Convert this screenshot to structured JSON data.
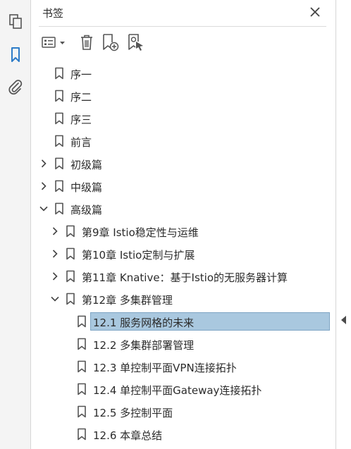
{
  "panel": {
    "title": "书签",
    "close_icon": "close-icon"
  },
  "rail": {
    "items": [
      {
        "icon": "pages-icon",
        "active": false
      },
      {
        "icon": "bookmark-icon",
        "active": true
      },
      {
        "icon": "attachment-icon",
        "active": false
      }
    ]
  },
  "toolbar": {
    "options_icon": "options-menu-icon",
    "delete_icon": "delete-icon",
    "new_bookmark_icon": "new-bookmark-icon",
    "new_from_structure_icon": "new-bookmark-from-structure-icon"
  },
  "colors": {
    "selection": "#a9c8df",
    "accent": "#2d7cc8"
  },
  "bookmarks": [
    {
      "label": "序一",
      "level": 0,
      "expander": "none",
      "selected": false
    },
    {
      "label": "序二",
      "level": 0,
      "expander": "none",
      "selected": false
    },
    {
      "label": "序三",
      "level": 0,
      "expander": "none",
      "selected": false
    },
    {
      "label": "前言",
      "level": 0,
      "expander": "none",
      "selected": false
    },
    {
      "label": "初级篇",
      "level": 0,
      "expander": "collapsed",
      "selected": false
    },
    {
      "label": "中级篇",
      "level": 0,
      "expander": "collapsed",
      "selected": false
    },
    {
      "label": "高级篇",
      "level": 0,
      "expander": "expanded",
      "selected": false
    },
    {
      "label": "第9章 Istio稳定性与运维",
      "level": 1,
      "expander": "collapsed",
      "selected": false
    },
    {
      "label": "第10章 Istio定制与扩展",
      "level": 1,
      "expander": "collapsed",
      "selected": false
    },
    {
      "label": "第11章 Knative：基于Istio的无服务器计算",
      "level": 1,
      "expander": "collapsed",
      "selected": false
    },
    {
      "label": "第12章 多集群管理",
      "level": 1,
      "expander": "expanded",
      "selected": false
    },
    {
      "label": "12.1 服务网格的未来",
      "level": 2,
      "expander": "none",
      "selected": true
    },
    {
      "label": "12.2 多集群部署管理",
      "level": 2,
      "expander": "none",
      "selected": false
    },
    {
      "label": "12.3 单控制平面VPN连接拓扑",
      "level": 2,
      "expander": "none",
      "selected": false
    },
    {
      "label": "12.4 单控制平面Gateway连接拓扑",
      "level": 2,
      "expander": "none",
      "selected": false
    },
    {
      "label": "12.5 多控制平面",
      "level": 2,
      "expander": "none",
      "selected": false
    },
    {
      "label": "12.6 本章总结",
      "level": 2,
      "expander": "none",
      "selected": false
    }
  ]
}
